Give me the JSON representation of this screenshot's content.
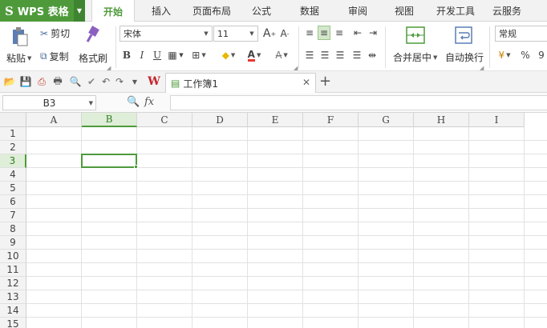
{
  "app": {
    "name": "WPS 表格",
    "logo_letter": "S"
  },
  "tabs": [
    {
      "label": "开始",
      "active": true
    },
    {
      "label": "插入"
    },
    {
      "label": "页面布局"
    },
    {
      "label": "公式"
    },
    {
      "label": "数据"
    },
    {
      "label": "审阅"
    },
    {
      "label": "视图"
    },
    {
      "label": "开发工具"
    },
    {
      "label": "云服务"
    }
  ],
  "ribbon": {
    "paste_label": "粘贴",
    "cut_label": "剪切",
    "copy_label": "复制",
    "format_painter_label": "格式刷",
    "font_name": "宋体",
    "font_size": "11",
    "grow_font": "A",
    "shrink_font": "A",
    "bold": "B",
    "italic": "I",
    "underline": "U",
    "font_color_letter": "A",
    "merge_center_label": "合并居中",
    "wrap_text_label": "自动换行",
    "number_format": "常规",
    "percent": "%",
    "comma": "9"
  },
  "document": {
    "tab_title": "工作簿1"
  },
  "formula_bar": {
    "cell_ref": "B3",
    "fx": "fx",
    "content": ""
  },
  "sheet": {
    "columns": [
      "A",
      "B",
      "C",
      "D",
      "E",
      "F",
      "G",
      "H",
      "I"
    ],
    "rows": [
      "1",
      "2",
      "3",
      "4",
      "5",
      "6",
      "7",
      "8",
      "9",
      "10",
      "11",
      "12",
      "13",
      "14",
      "15"
    ],
    "selected_column": "B",
    "selected_row": "3"
  },
  "colors": {
    "accent": "#4e9a3b",
    "wps_red": "#c7262e"
  }
}
